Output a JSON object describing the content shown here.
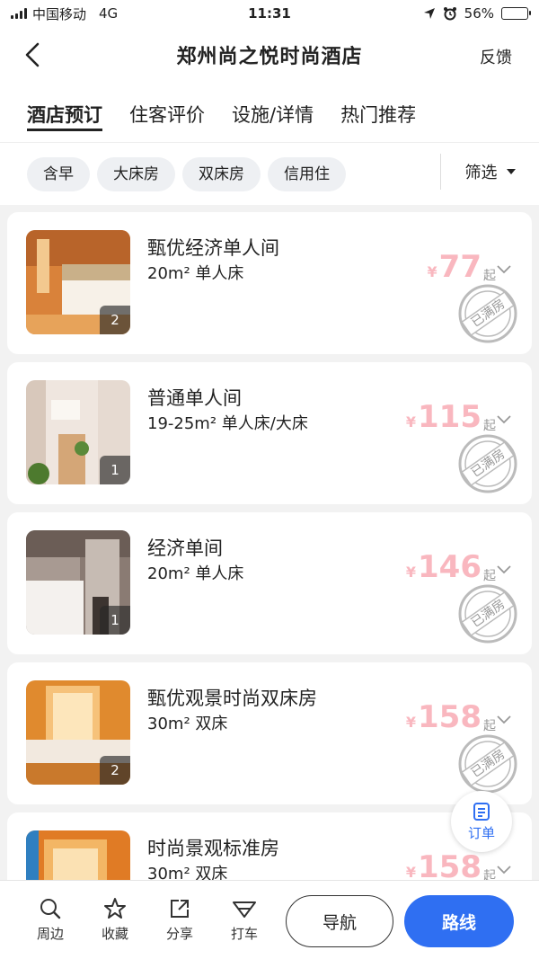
{
  "status_bar": {
    "carrier": "中国移动",
    "network": "4G",
    "time": "11:31",
    "battery": "56%",
    "battery_level": 0.56
  },
  "header": {
    "title": "郑州尚之悦时尚酒店",
    "feedback": "反馈"
  },
  "tabs": [
    {
      "label": "酒店预订",
      "active": true
    },
    {
      "label": "住客评价",
      "active": false
    },
    {
      "label": "设施/详情",
      "active": false
    },
    {
      "label": "热门推荐",
      "active": false
    }
  ],
  "filters": {
    "chips": [
      "含早",
      "大床房",
      "双床房",
      "信用住"
    ],
    "filter_label": "筛选"
  },
  "rooms": [
    {
      "name": "甄优经济单人间",
      "spec": "20m² 单人床",
      "price": "77",
      "currency": "¥",
      "qi": "起",
      "photos": "2",
      "status": "已满房"
    },
    {
      "name": "普通单人间",
      "spec": "19-25m² 单人床/大床",
      "price": "115",
      "currency": "¥",
      "qi": "起",
      "photos": "1",
      "status": "已满房"
    },
    {
      "name": "经济单间",
      "spec": "20m² 单人床",
      "price": "146",
      "currency": "¥",
      "qi": "起",
      "photos": "1",
      "status": "已满房"
    },
    {
      "name": "甄优观景时尚双床房",
      "spec": "30m² 双床",
      "price": "158",
      "currency": "¥",
      "qi": "起",
      "photos": "2",
      "status": "已满房"
    },
    {
      "name": "时尚景观标准房",
      "spec": "30m² 双床",
      "price": "158",
      "currency": "¥",
      "qi": "起",
      "photos": "",
      "status": ""
    }
  ],
  "fab": {
    "label": "订单"
  },
  "bottom_bar": {
    "items": [
      {
        "label": "周边",
        "icon": "search-icon"
      },
      {
        "label": "收藏",
        "icon": "star-icon"
      },
      {
        "label": "分享",
        "icon": "share-icon"
      },
      {
        "label": "打车",
        "icon": "car-icon"
      }
    ],
    "nav_button": "导航",
    "route_button": "路线"
  },
  "colors": {
    "accent": "#2f6ff2",
    "price": "#f9b7bf"
  }
}
